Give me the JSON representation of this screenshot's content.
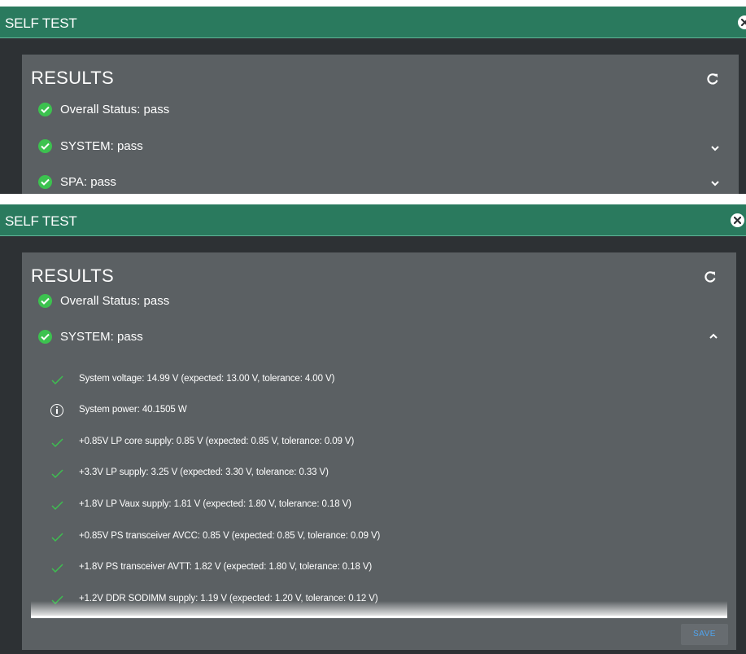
{
  "colors": {
    "title_bar": "#2a7a5e",
    "window_bg": "#2d3134",
    "panel_bg": "#5b6063",
    "pass_green": "#3cc24f",
    "save_text": "#4fa3ee"
  },
  "collapsed_view": {
    "window": {
      "title": "SELF TEST",
      "close_icon": "close-circle-icon"
    },
    "results": {
      "heading": "RESULTS",
      "refresh_icon": "refresh-icon",
      "overall_status": "Overall Status: pass",
      "sections": [
        {
          "label": "SYSTEM: pass",
          "expanded": false,
          "chevron": "chevron-down-icon"
        },
        {
          "label": "SPA: pass",
          "expanded": false,
          "chevron": "chevron-down-icon"
        }
      ]
    }
  },
  "expanded_view": {
    "window": {
      "title": "SELF TEST",
      "close_icon": "close-circle-icon"
    },
    "results": {
      "heading": "RESULTS",
      "refresh_icon": "refresh-icon",
      "overall_status": "Overall Status: pass",
      "system_section": {
        "label": "SYSTEM: pass",
        "expanded": true,
        "chevron": "chevron-up-icon",
        "items": [
          {
            "icon": "check-icon",
            "text": "System voltage: 14.99 V (expected: 13.00 V, tolerance: 4.00 V)"
          },
          {
            "icon": "info-icon",
            "text": "System power: 40.1505 W"
          },
          {
            "icon": "check-icon",
            "text": "+0.85V LP core supply: 0.85 V (expected: 0.85 V, tolerance: 0.09 V)"
          },
          {
            "icon": "check-icon",
            "text": "+3.3V LP supply: 3.25 V (expected: 3.30 V, tolerance: 0.33 V)"
          },
          {
            "icon": "check-icon",
            "text": "+1.8V LP Vaux supply: 1.81 V (expected: 1.80 V, tolerance: 0.18 V)"
          },
          {
            "icon": "check-icon",
            "text": "+0.85V PS transceiver AVCC: 0.85 V (expected: 0.85 V, tolerance: 0.09 V)"
          },
          {
            "icon": "check-icon",
            "text": "+1.8V PS transceiver AVTT: 1.82 V (expected: 1.80 V, tolerance: 0.18 V)"
          },
          {
            "icon": "check-icon",
            "text": "+1.2V DDR SODIMM supply: 1.19 V (expected: 1.20 V, tolerance: 0.12 V)"
          }
        ]
      },
      "save_label": "SAVE"
    }
  }
}
